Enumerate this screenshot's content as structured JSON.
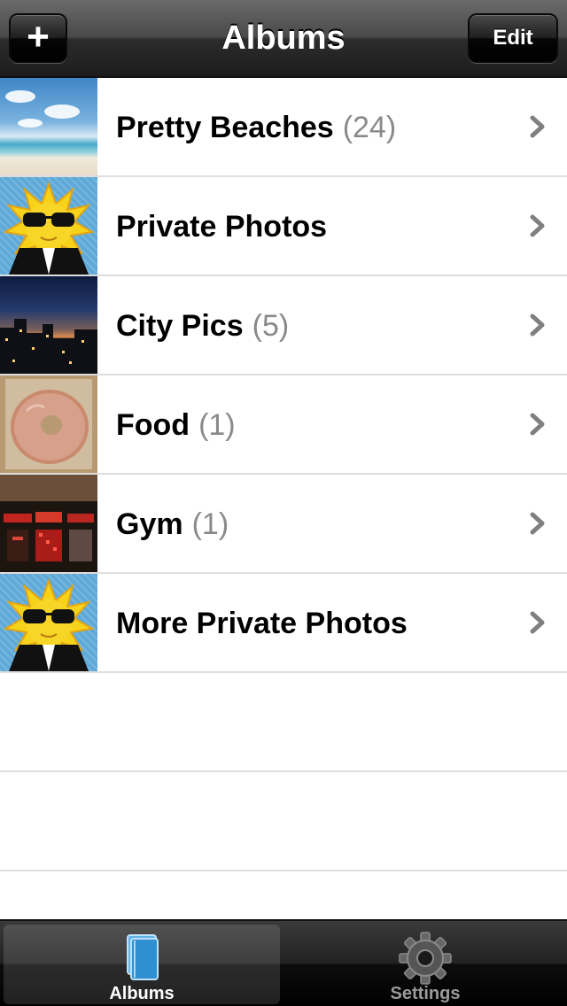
{
  "navbar": {
    "title": "Albums",
    "add_label": "+",
    "edit_label": "Edit"
  },
  "albums": [
    {
      "name": "Pretty Beaches",
      "count": "(24)",
      "thumb": "beach-photo"
    },
    {
      "name": "Private Photos",
      "count": "",
      "thumb": "sun-with-sunglasses-icon"
    },
    {
      "name": "City Pics",
      "count": "(5)",
      "thumb": "city-night-photo"
    },
    {
      "name": "Food",
      "count": "(1)",
      "thumb": "donut-photo"
    },
    {
      "name": "Gym",
      "count": "(1)",
      "thumb": "gym-machine-photo"
    },
    {
      "name": "More Private Photos",
      "count": "",
      "thumb": "sun-with-sunglasses-icon"
    }
  ],
  "tabbar": {
    "tabs": [
      {
        "label": "Albums",
        "icon": "book-icon",
        "selected": true
      },
      {
        "label": "Settings",
        "icon": "gear-icon",
        "selected": false
      }
    ]
  },
  "colors": {
    "count_text": "#8a8a8a",
    "chevron": "#7f7f7f",
    "separator": "#dedede"
  }
}
